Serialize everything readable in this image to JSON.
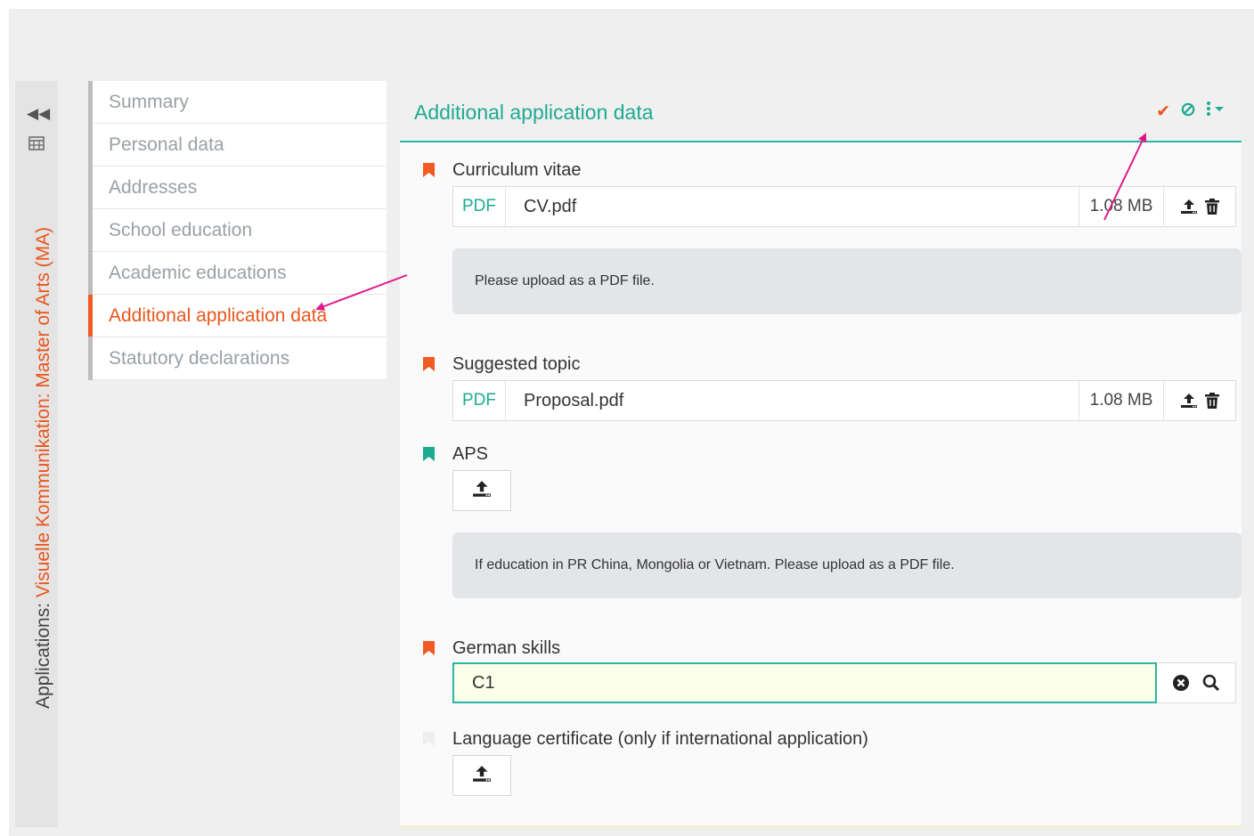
{
  "sidebar_strip": {
    "collapse_icon": "double-chevron-left-icon",
    "grid_icon": "table-icon",
    "title_prefix": "Applications: ",
    "title_program": "Visuelle Kommunikation: Master of Arts (MA)"
  },
  "nav": {
    "items": [
      {
        "label": "Summary"
      },
      {
        "label": "Personal data"
      },
      {
        "label": "Addresses"
      },
      {
        "label": "School education"
      },
      {
        "label": "Academic educations"
      },
      {
        "label": "Additional application data"
      },
      {
        "label": "Statutory declarations"
      }
    ],
    "active_index": 5
  },
  "panel": {
    "title": "Additional application data",
    "header_icons": [
      "check-icon",
      "ban-icon",
      "more-vertical-icon",
      "caret-down-icon"
    ],
    "fields": {
      "cv": {
        "label": "Curriculum vitae",
        "file_type": "PDF",
        "file_name": "CV.pdf",
        "file_size": "1.08 MB",
        "hint": "Please upload as a PDF file."
      },
      "topic": {
        "label": "Suggested topic",
        "file_type": "PDF",
        "file_name": "Proposal.pdf",
        "file_size": "1.08 MB"
      },
      "aps": {
        "label": "APS",
        "hint": "If education in PR China, Mongolia or Vietnam. Please upload as a PDF file."
      },
      "german": {
        "label": "German skills",
        "value": "C1"
      },
      "language_certificate": {
        "label": "Language certificate (only if international application)"
      }
    }
  },
  "colors": {
    "accent_teal": "#1eaa92",
    "accent_orange": "#e9561d",
    "annotation_pink": "#e0198a"
  }
}
